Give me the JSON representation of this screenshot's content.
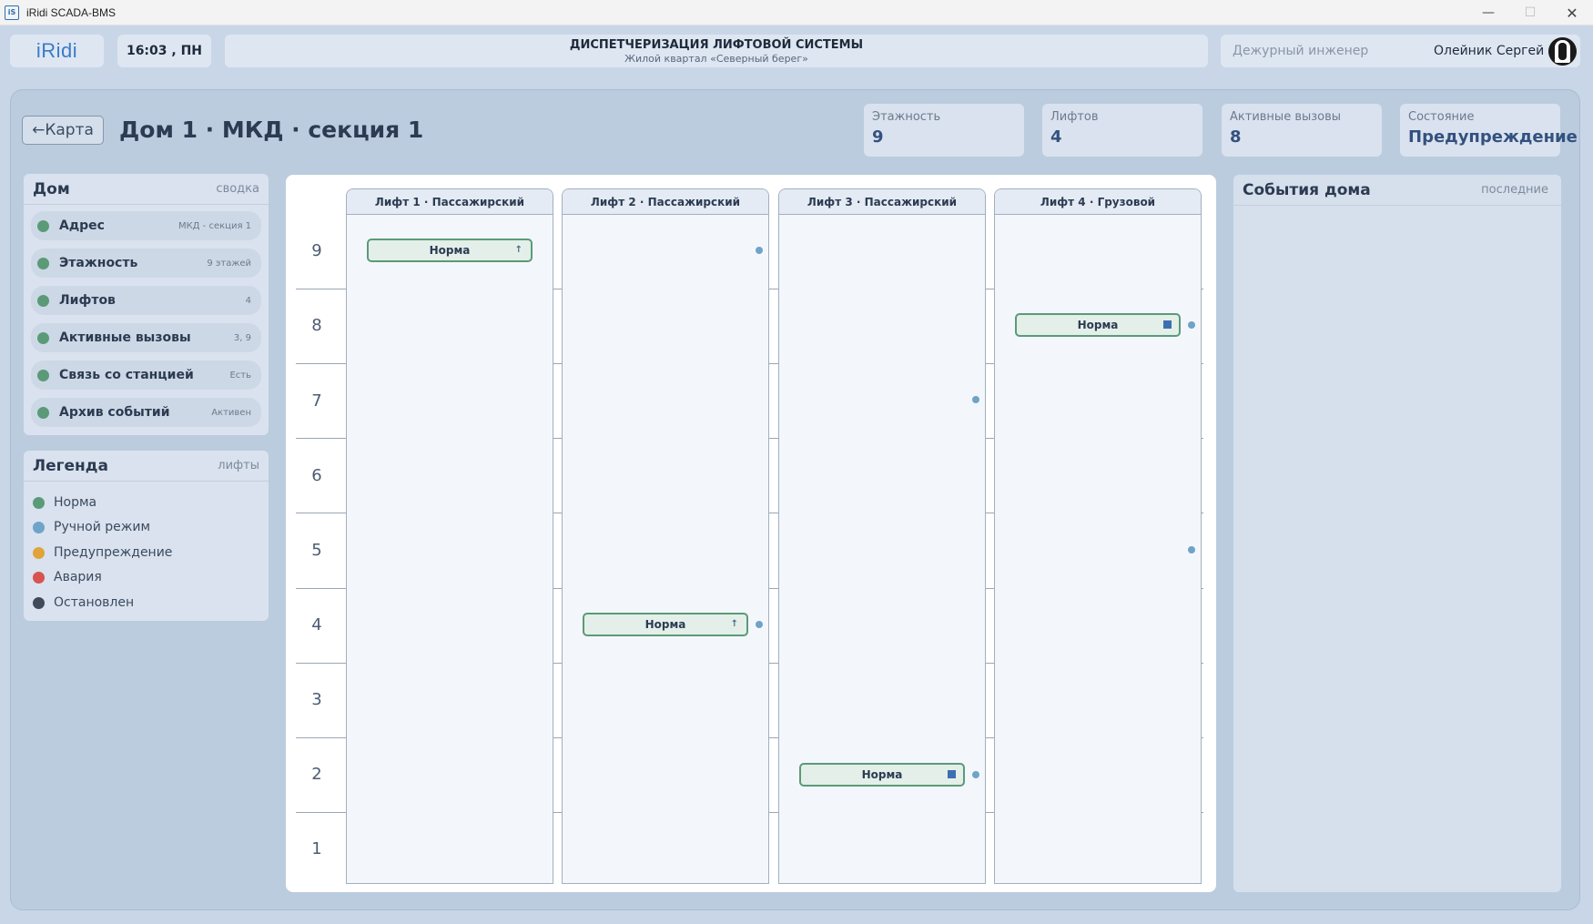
{
  "window": {
    "app_icon": "iS",
    "title": "iRidi SCADA-BMS",
    "min_glyph": "—",
    "max_glyph": "☐",
    "close_glyph": "✕"
  },
  "header": {
    "logo": "iRidi",
    "clock": "16:03 , ПН",
    "title": "ДИСПЕТЧЕРИЗАЦИЯ ЛИФТОВОЙ СИСТЕМЫ",
    "subtitle": "Жилой квартал «Северный берег»",
    "role": "Дежурный инженер",
    "user": "Олейник Сергей"
  },
  "page": {
    "back_label": "←Карта",
    "title": "Дом 1 · МКД · секция 1"
  },
  "stats": [
    {
      "label": "Этажность",
      "value": "9"
    },
    {
      "label": "Лифтов",
      "value": "4"
    },
    {
      "label": "Активные вызовы",
      "value": "8"
    },
    {
      "label": "Состояние",
      "value": "Предупреждение"
    }
  ],
  "house": {
    "title": "Дом",
    "subtitle": "сводка",
    "rows": [
      {
        "name": "Адрес",
        "value": "МКД - секция 1"
      },
      {
        "name": "Этажность",
        "value": "9 этажей"
      },
      {
        "name": "Лифтов",
        "value": "4"
      },
      {
        "name": "Активные вызовы",
        "value": "3, 9"
      },
      {
        "name": "Связь со станцией",
        "value": "Есть"
      },
      {
        "name": "Архив событий",
        "value": "Активен"
      }
    ]
  },
  "legend": {
    "title": "Легенда",
    "subtitle": "лифты",
    "items": [
      {
        "label": "Норма",
        "color": "#5b9a78"
      },
      {
        "label": "Ручной режим",
        "color": "#6fa3c8"
      },
      {
        "label": "Предупреждение",
        "color": "#e0a43a"
      },
      {
        "label": "Авария",
        "color": "#d9534f"
      },
      {
        "label": "Остановлен",
        "color": "#3f4a5a"
      }
    ]
  },
  "floors": [
    "9",
    "8",
    "7",
    "6",
    "5",
    "4",
    "3",
    "2",
    "1"
  ],
  "elevators": [
    {
      "name": "Лифт 1 · Пассажирский",
      "car_floor": 9,
      "status": "Норма",
      "direction": "↑"
    },
    {
      "name": "Лифт 2 · Пассажирский",
      "car_floor": 4,
      "status": "Норма",
      "direction": "↑"
    },
    {
      "name": "Лифт 3 · Пассажирский",
      "car_floor": 2,
      "status": "Норма",
      "direction": "stop"
    },
    {
      "name": "Лифт 4 · Грузовой",
      "car_floor": 8,
      "status": "Норма",
      "direction": "stop"
    }
  ],
  "calls": [
    {
      "elevator": 2,
      "floor": 9
    },
    {
      "elevator": 2,
      "floor": 4
    },
    {
      "elevator": 3,
      "floor": 7
    },
    {
      "elevator": 3,
      "floor": 2
    },
    {
      "elevator": 4,
      "floor": 8
    },
    {
      "elevator": 4,
      "floor": 5
    }
  ],
  "events": {
    "title": "События дома",
    "subtitle": "последние"
  }
}
